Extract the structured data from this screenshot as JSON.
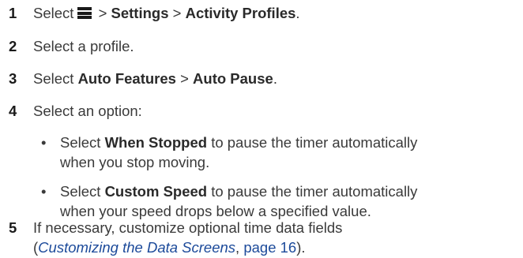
{
  "steps": [
    {
      "number": "1",
      "pre": "Select",
      "sep1": ">",
      "item1": "Settings",
      "sep2": ">",
      "item2": "Activity Profiles",
      "end": "."
    },
    {
      "number": "2",
      "text": "Select a profile."
    },
    {
      "number": "3",
      "pre": "Select",
      "item1": "Auto Features",
      "sep": ">",
      "item2": "Auto Pause",
      "end": "."
    },
    {
      "number": "4",
      "text": "Select an option:"
    },
    {
      "number": "5",
      "line1": "If necessary, customize optional time data fields",
      "open": "(",
      "link": "Customizing the Data Screens",
      "comma": ",",
      "page": "page 16",
      "close": ")."
    }
  ],
  "options": [
    {
      "bullet": "•",
      "pre": "Select",
      "bold": "When Stopped",
      "post": "to pause the timer automatically",
      "line2": "when you stop moving."
    },
    {
      "bullet": "•",
      "pre": "Select",
      "bold": "Custom Speed",
      "post": "to pause the timer automatically",
      "line2": "when your speed drops below a specified value."
    }
  ],
  "icons": {
    "menu": "menu-icon"
  }
}
